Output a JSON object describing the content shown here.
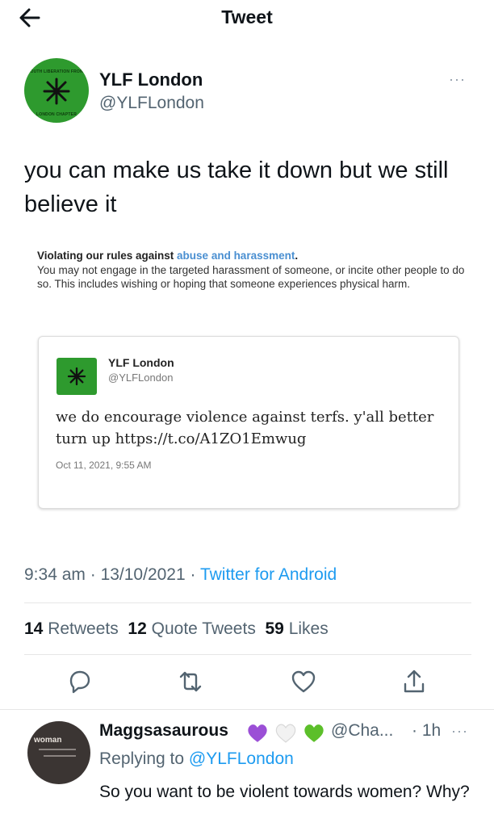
{
  "header": {
    "title": "Tweet",
    "back_icon": "arrow-left-icon"
  },
  "tweet": {
    "display_name": "YLF London",
    "handle": "@YLFLondon",
    "avatar_top_text": "YOUTH LIBERATION FRONT",
    "avatar_bottom_text": "LONDON CHAPTER",
    "text": "you can make us take it down but we still believe it",
    "more_label": "···"
  },
  "notice": {
    "heading": "Violating our rules against ",
    "link": "abuse and harassment",
    "heading_end": ".",
    "body": "You may not engage in the targeted harassment of someone, or incite other people to do so. This includes wishing or hoping that someone experiences physical harm."
  },
  "quoted": {
    "display_name": "YLF London",
    "handle": "@YLFLondon",
    "text": "we do encourage violence against terfs. y'all better turn up https://t.co/A1ZO1Emwug",
    "timestamp": "Oct 11, 2021, 9:55 AM"
  },
  "meta": {
    "time": "9:34 am",
    "date": "13/10/2021",
    "separator": " · ",
    "source": "Twitter for Android"
  },
  "stats": {
    "retweets_count": "14",
    "retweets_label": "Retweets",
    "quotes_count": "12",
    "quotes_label": "Quote Tweets",
    "likes_count": "59",
    "likes_label": "Likes"
  },
  "actions": [
    "reply-icon",
    "retweet-icon",
    "like-icon",
    "share-icon"
  ],
  "reply": {
    "display_name": "Maggsasaurous",
    "handle": "@Cha...",
    "time": "· 1h",
    "replying_prefix": "Replying to ",
    "replying_handle": "@YLFLondon",
    "text": "So you want to be violent towards women? Why?",
    "avatar_text": "woman",
    "more_label": "···"
  },
  "colors": {
    "accent": "#1d9bf0",
    "muted": "#536471",
    "avatar_green": "#2e9a2e"
  }
}
